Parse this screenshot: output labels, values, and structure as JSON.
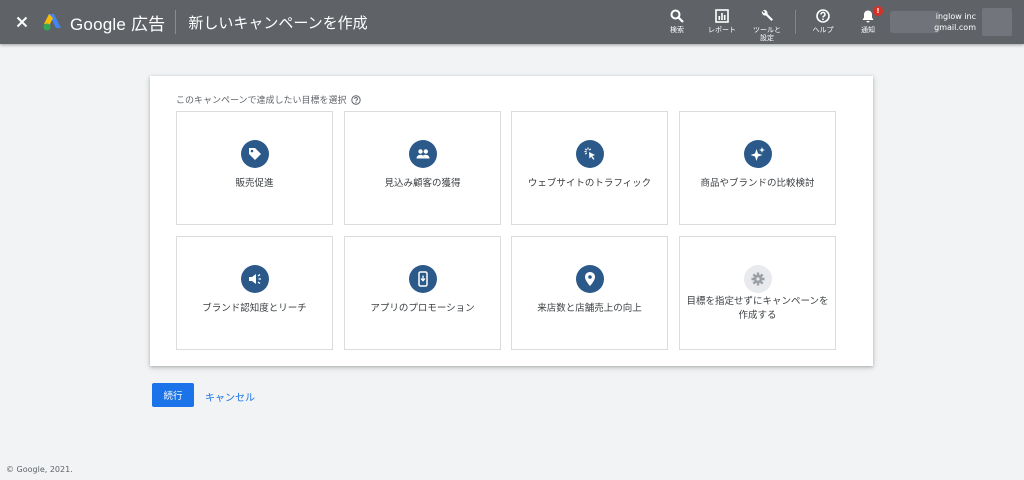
{
  "header": {
    "brand": "Google 広告",
    "page_title": "新しいキャンペーンを作成",
    "tools": [
      {
        "icon": "search-icon",
        "label": "検索"
      },
      {
        "icon": "reports-icon",
        "label": "レポート"
      },
      {
        "icon": "wrench-icon",
        "label": "ツールと設定"
      },
      {
        "icon": "help-icon",
        "label": "ヘルプ"
      },
      {
        "icon": "bell-icon",
        "label": "通知"
      }
    ],
    "notification_badge": "!",
    "account_line1": "inglow inc",
    "account_line2": "gmail.com"
  },
  "card": {
    "title": "このキャンペーンで達成したい目標を選択",
    "goals": [
      {
        "icon": "tag-icon",
        "label": "販売促進"
      },
      {
        "icon": "people-icon",
        "label": "見込み顧客の獲得"
      },
      {
        "icon": "cursor-click-icon",
        "label": "ウェブサイトのトラフィック"
      },
      {
        "icon": "sparkle-icon",
        "label": "商品やブランドの比較検討"
      },
      {
        "icon": "speaker-icon",
        "label": "ブランド認知度とリーチ"
      },
      {
        "icon": "phone-icon",
        "label": "アプリのプロモーション"
      },
      {
        "icon": "location-pin-icon",
        "label": "来店数と店舗売上の向上"
      },
      {
        "icon": "gear-icon",
        "label": "目標を指定せずにキャンペーンを作成する"
      }
    ]
  },
  "actions": {
    "continue_label": "続行",
    "cancel_label": "キャンセル"
  },
  "footer": {
    "copyright": "© Google, 2021."
  },
  "colors": {
    "header_bg": "#5f6368",
    "accent": "#1a73e8",
    "icon_circle": "#2b5a8a"
  }
}
